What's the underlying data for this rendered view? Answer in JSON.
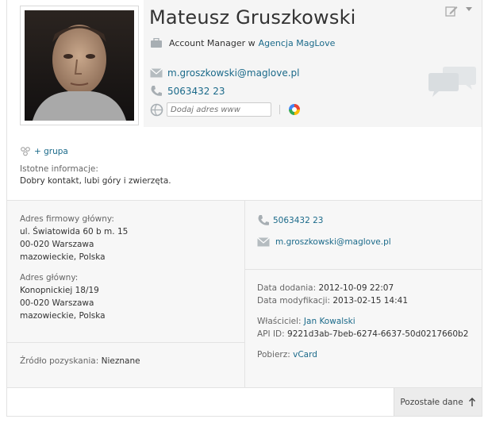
{
  "contact": {
    "name": "Mateusz Gruszkowski",
    "position": "Account Manager w",
    "company": "Agencja MagLove",
    "email": "m.groszkowski@maglove.pl",
    "phone": "5063432 23",
    "www_placeholder": "Dodaj adres www"
  },
  "group": {
    "label": "+ grupa"
  },
  "notes": {
    "label": "Istotne informacje:",
    "text": "Dobry kontakt, lubi góry i zwierzęta."
  },
  "addresses": {
    "company": {
      "label": "Adres firmowy główny:",
      "line1": "ul. Światowida 60 b m. 15",
      "line2": "00-020 Warszawa",
      "line3": "mazowieckie, Polska"
    },
    "main": {
      "label": "Adres główny:",
      "line1": "Konopnickiej 18/19",
      "line2": "00-020 Warszawa",
      "line3": "mazowieckie, Polska"
    },
    "source": {
      "label": "Źródło pozyskania:",
      "value": "Nieznane"
    }
  },
  "details": {
    "phone": "5063432 23",
    "email": "m.groszkowski@maglove.pl",
    "added_label": "Data dodania:",
    "added_value": "2012-10-09 22:07",
    "modified_label": "Data modyfikacji:",
    "modified_value": "2013-02-15 14:41",
    "owner_label": "Właściciel:",
    "owner_value": "Jan Kowalski",
    "api_label": "API ID:",
    "api_value": "9221d3ab-7beb-6274-6637-50d0217660b2",
    "download_label": "Pobierz:",
    "download_value": "vCard"
  },
  "footer": {
    "more_label": "Pozostałe dane"
  },
  "colors": {
    "link": "#1b6a8a",
    "text": "#333333",
    "panel": "#f5f5f5"
  }
}
